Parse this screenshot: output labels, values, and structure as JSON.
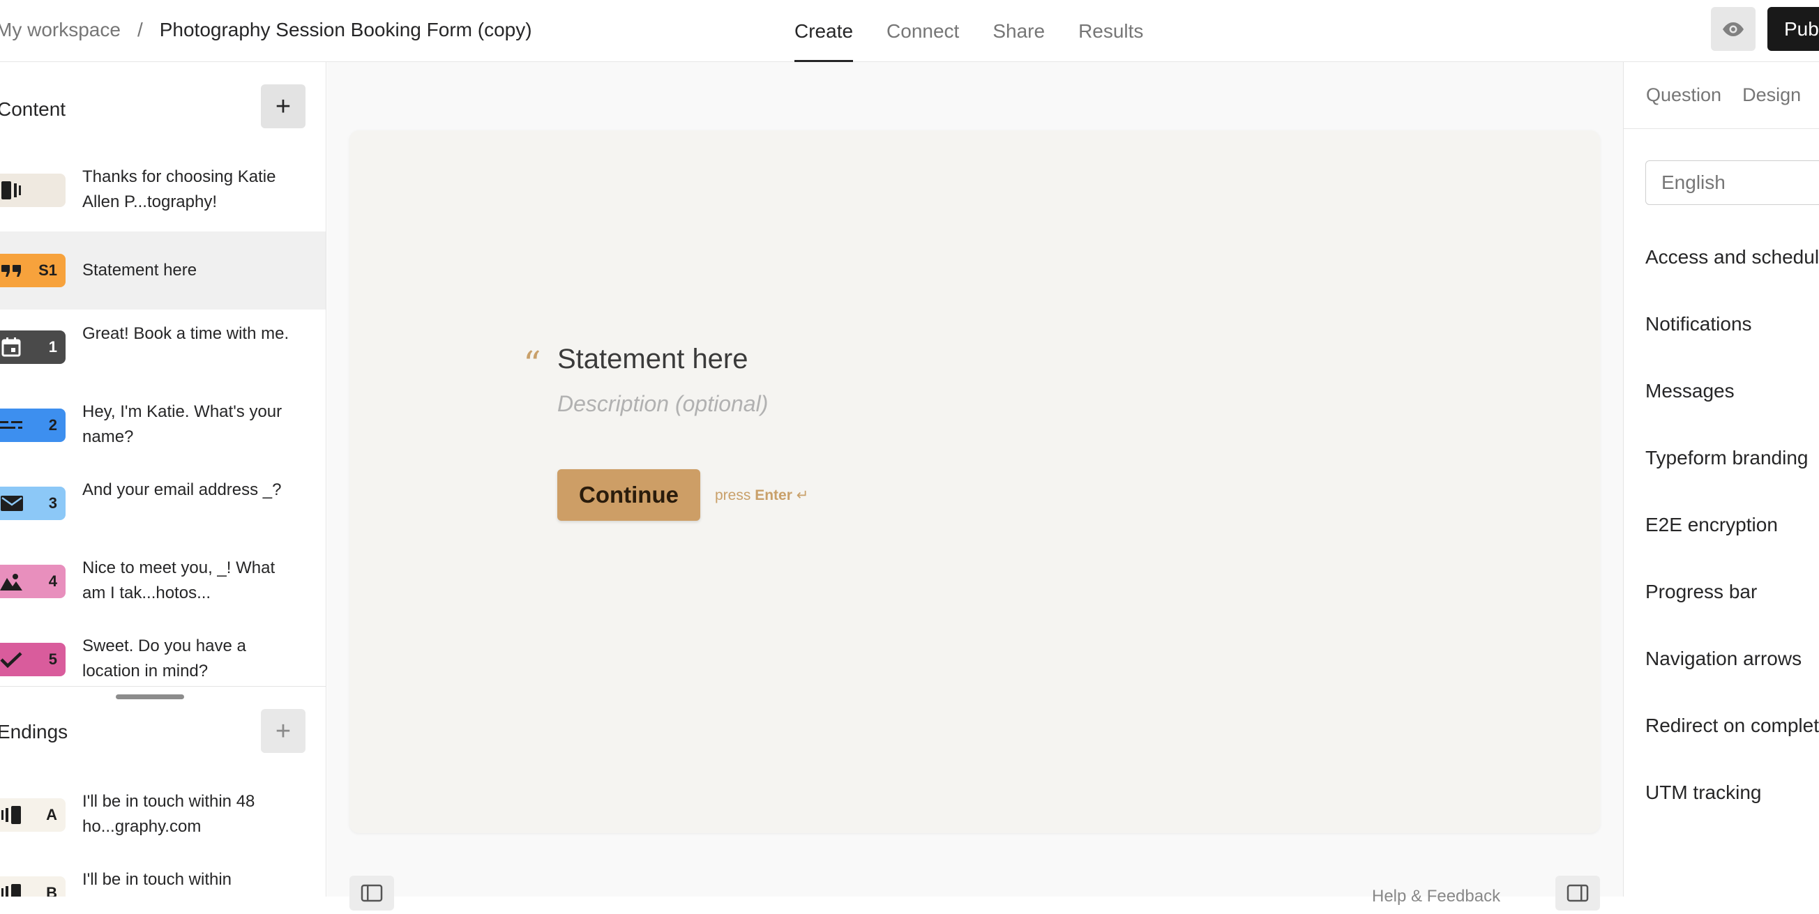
{
  "breadcrumb": {
    "workspace": "My workspace",
    "separator": "/",
    "form_name": "Photography Session Booking Form (copy)"
  },
  "nav_tabs": [
    {
      "label": "Create",
      "active": true
    },
    {
      "label": "Connect",
      "active": false
    },
    {
      "label": "Share",
      "active": false
    },
    {
      "label": "Results",
      "active": false
    }
  ],
  "toolbar": {
    "preview_icon": "eye-icon",
    "publish_label": "Publish"
  },
  "content_section": {
    "title": "Content",
    "add_label": "+",
    "items": [
      {
        "badge": "",
        "icon": "welcome-screen-icon",
        "color": "#efe9e0",
        "text": "Thanks for choosing Katie Allen P...tography!"
      },
      {
        "badge": "S1",
        "icon": "quote-icon",
        "color": "#f7a23c",
        "text": "Statement here",
        "selected": true
      },
      {
        "badge": "1",
        "icon": "calendar-icon",
        "color": "#4a4a4a",
        "text": "Great! Book a time with me."
      },
      {
        "badge": "2",
        "icon": "short-text-icon",
        "color": "#3d8fef",
        "text": "Hey, I'm Katie. What's your name?"
      },
      {
        "badge": "3",
        "icon": "email-icon",
        "color": "#8cc8f7",
        "text": "And your email address _?"
      },
      {
        "badge": "4",
        "icon": "picture-choice-icon",
        "color": "#e88fbd",
        "text": "Nice to meet you, _! What am I tak...hotos..."
      },
      {
        "badge": "5",
        "icon": "checkmark-icon",
        "color": "#d95c9c",
        "text": "Sweet. Do you have a location in mind?"
      }
    ]
  },
  "endings_section": {
    "title": "Endings",
    "add_label": "+",
    "items": [
      {
        "badge": "A",
        "icon": "ending-screen-icon",
        "color": "#f6f2ea",
        "text": "I'll be in touch within 48 ho...graphy.com"
      },
      {
        "badge": "B",
        "icon": "ending-screen-icon",
        "color": "#f6f2ea",
        "text": "I'll be in touch within"
      }
    ]
  },
  "canvas": {
    "quote_mark": "“",
    "statement_title": "Statement here",
    "statement_description": "Description (optional)",
    "continue_label": "Continue",
    "press_prefix": "press ",
    "press_key": "Enter",
    "press_symbol": " ↵",
    "help_text": "Help & Feedback"
  },
  "right_panel": {
    "tabs": [
      {
        "label": "Question"
      },
      {
        "label": "Design"
      }
    ],
    "language": "English",
    "settings": [
      "Access and scheduling",
      "Notifications",
      "Messages",
      "Typeform branding",
      "E2E encryption",
      "Progress bar",
      "Navigation arrows",
      "Redirect on completion",
      "UTM tracking"
    ]
  }
}
